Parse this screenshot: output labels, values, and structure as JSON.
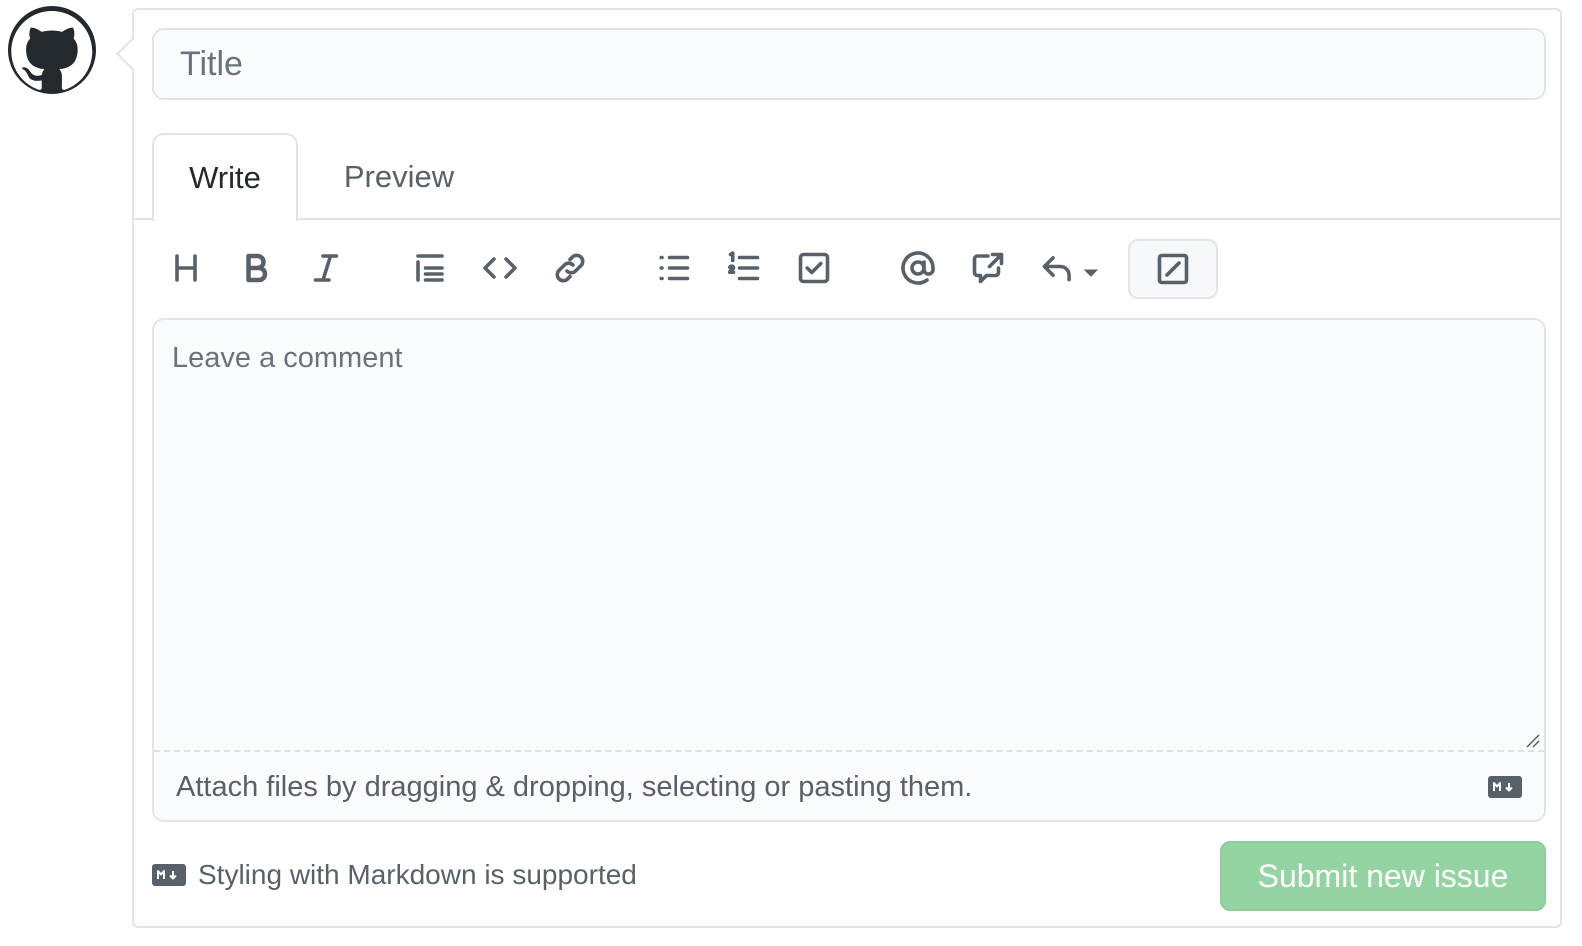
{
  "form": {
    "title_placeholder": "Title",
    "tabs": [
      {
        "label": "Write",
        "active": true
      },
      {
        "label": "Preview",
        "active": false
      }
    ],
    "toolbar": [
      {
        "name": "heading",
        "icon": "heading-icon"
      },
      {
        "name": "bold",
        "icon": "bold-icon"
      },
      {
        "name": "italic",
        "icon": "italic-icon"
      },
      {
        "name": "quote",
        "icon": "quote-icon"
      },
      {
        "name": "code",
        "icon": "code-icon"
      },
      {
        "name": "link",
        "icon": "link-icon"
      },
      {
        "name": "bulleted-list",
        "icon": "unordered-list-icon"
      },
      {
        "name": "numbered-list",
        "icon": "ordered-list-icon"
      },
      {
        "name": "task-list",
        "icon": "tasklist-icon"
      },
      {
        "name": "mention",
        "icon": "mention-icon"
      },
      {
        "name": "cross-reference",
        "icon": "cross-reference-icon"
      },
      {
        "name": "saved-replies",
        "icon": "reply-icon"
      },
      {
        "name": "fullscreen",
        "icon": "fullscreen-icon"
      }
    ],
    "comment_placeholder": "Leave a comment",
    "attach_text": "Attach files by dragging & dropping, selecting or pasting them.",
    "markdown_note": "Styling with Markdown is supported",
    "submit_label": "Submit new issue",
    "submit_disabled": true
  },
  "colors": {
    "submit_bg": "#94d3a2",
    "border": "#e1e4e8",
    "input_bg": "#fafbfc",
    "icon": "#586069"
  }
}
